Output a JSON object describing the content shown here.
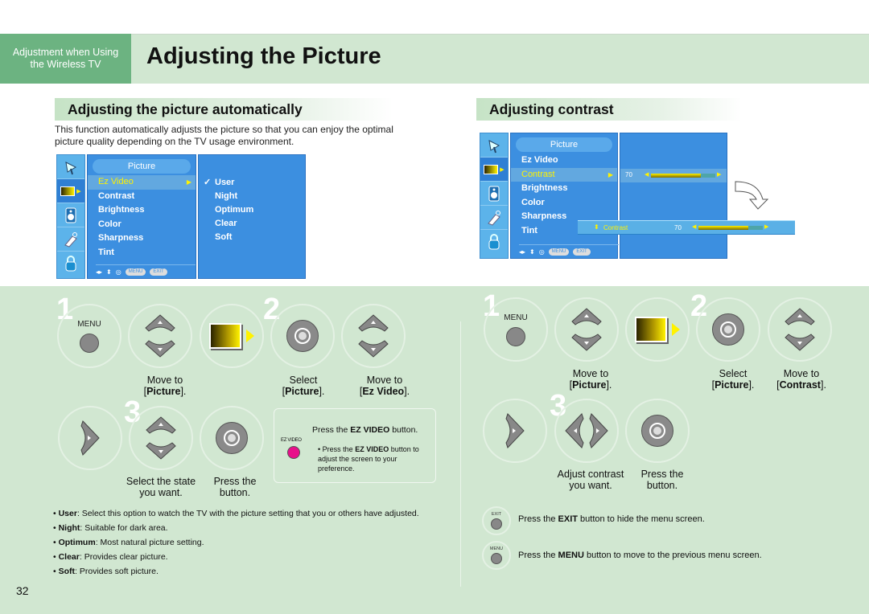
{
  "header": {
    "section_tab": [
      "Adjustment when Using",
      "the Wireless TV"
    ],
    "title": "Adjusting the Picture"
  },
  "left": {
    "heading": "Adjusting the picture automatically",
    "intro": "This function automatically adjusts the picture so that you can enjoy the optimal picture quality depending on the TV usage environment.",
    "menu": {
      "title": "Picture",
      "items": [
        "Ez Video",
        "Contrast",
        "Brightness",
        "Color",
        "Sharpness",
        "Tint"
      ],
      "selected": "Ez Video",
      "sub_options": [
        "User",
        "Night",
        "Optimum",
        "Clear",
        "Soft"
      ],
      "checked": "User",
      "footer_menu": "MENU",
      "footer_exit": "EXIT"
    },
    "steps": {
      "step1": "1",
      "step2": "2",
      "step3": "3",
      "menu_label": "MENU",
      "cap_move_picture": [
        "Move to",
        "[",
        "Picture",
        "]."
      ],
      "cap_select_picture": [
        "Select",
        "[",
        "Picture",
        "]."
      ],
      "cap_move_ezvideo": [
        "Move to",
        "[",
        "Ez Video",
        "]."
      ],
      "cap_select_state": [
        "Select the state",
        "you want."
      ],
      "cap_press": [
        "Press the",
        "button."
      ]
    },
    "ezvideo_box": {
      "heading_pre": "Press the ",
      "heading_bold": "EZ VIDEO",
      "heading_post": " button.",
      "button_label": "EZ VIDEO",
      "button_color": "#e8108a",
      "bullet_pre": "Press the ",
      "bullet_bold": "EZ VIDEO",
      "bullet_post": " button to adjust the screen to your preference."
    },
    "bullets": [
      {
        "term": "User",
        "desc": ": Select this option to watch the TV with the picture setting that you or others have adjusted."
      },
      {
        "term": "Night",
        "desc": ": Suitable for dark area."
      },
      {
        "term": "Optimum",
        "desc": ": Most natural picture setting."
      },
      {
        "term": "Clear",
        "desc": ": Provides clear picture."
      },
      {
        "term": "Soft",
        "desc": ": Provides soft picture."
      }
    ]
  },
  "right": {
    "heading": "Adjusting contrast",
    "menu": {
      "title": "Picture",
      "items": [
        "Ez Video",
        "Contrast",
        "Brightness",
        "Color",
        "Sharpness",
        "Tint"
      ],
      "selected": "Contrast",
      "value": "70",
      "value_fraction": 0.78,
      "popup_label": "Contrast",
      "popup_value": "70",
      "footer_menu": "MENU",
      "footer_exit": "EXIT"
    },
    "steps": {
      "step1": "1",
      "step2": "2",
      "step3": "3",
      "menu_label": "MENU",
      "cap_move_picture": [
        "Move to",
        "[",
        "Picture",
        "]."
      ],
      "cap_select_picture": [
        "Select",
        "[",
        "Picture",
        "]."
      ],
      "cap_move_contrast": [
        "Move to",
        "[",
        "Contrast",
        "]."
      ],
      "cap_adjust": [
        "Adjust contrast",
        "you want."
      ],
      "cap_press": [
        "Press the",
        "button."
      ]
    },
    "notes": [
      {
        "btn": "EXIT",
        "pre": "Press the ",
        "bold": "EXIT",
        "post": " button to hide the menu screen."
      },
      {
        "btn": "MENU",
        "pre": "Press the ",
        "bold": "MENU",
        "post": " button to move to the previous menu screen."
      }
    ]
  },
  "page_number": "32"
}
